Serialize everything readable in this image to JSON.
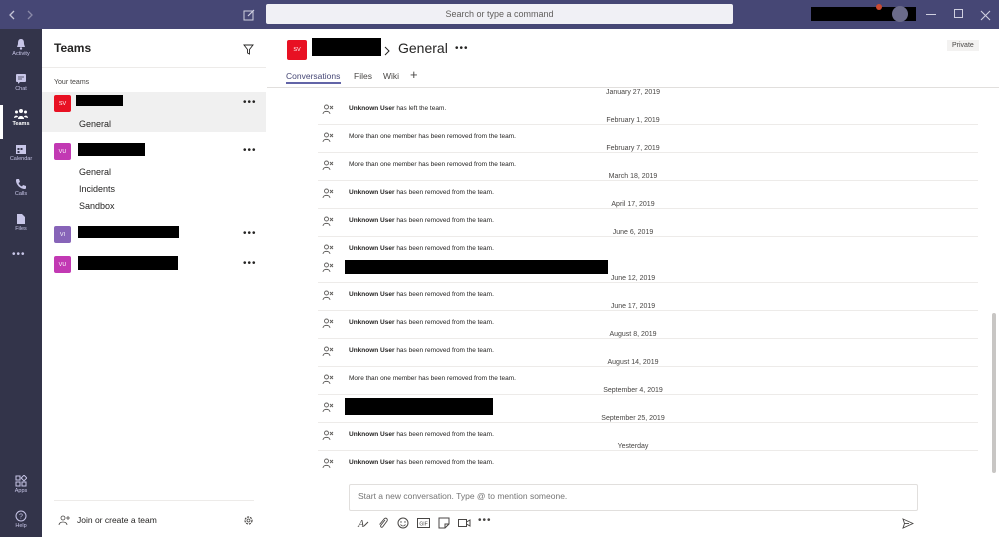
{
  "titlebar": {
    "search_placeholder": "Search or type a command",
    "icons": [
      "chevron-left-icon",
      "chevron-right-icon",
      "compose-icon",
      "minimize-icon",
      "restore-icon",
      "close-icon"
    ]
  },
  "rail": {
    "items": [
      {
        "label": "Activity",
        "icon": "bell-icon"
      },
      {
        "label": "Chat",
        "icon": "chat-icon"
      },
      {
        "label": "Teams",
        "icon": "teams-icon"
      },
      {
        "label": "Calendar",
        "icon": "calendar-icon"
      },
      {
        "label": "Calls",
        "icon": "phone-icon"
      },
      {
        "label": "Files",
        "icon": "file-icon"
      }
    ],
    "more": "•••",
    "bottom": [
      {
        "label": "Apps",
        "icon": "apps-icon"
      },
      {
        "label": "Help",
        "icon": "help-icon"
      }
    ]
  },
  "teams_pane": {
    "title": "Teams",
    "section_label": "Your teams",
    "teams": [
      {
        "avatar": "SV",
        "color": "#e81123",
        "channels": [
          "General"
        ]
      },
      {
        "avatar": "VU",
        "color": "#c239b3",
        "channels": [
          "General",
          "Incidents",
          "Sandbox"
        ]
      },
      {
        "avatar": "VI",
        "color": "#8764b8",
        "channels": []
      },
      {
        "avatar": "VU",
        "color": "#c239b3",
        "channels": []
      }
    ],
    "more_dots": "•••",
    "join_label": "Join or create a team"
  },
  "channel_header": {
    "avatar": "SV",
    "channel_name": "General",
    "more": "•••",
    "privacy": "Private",
    "tabs": [
      "Conversations",
      "Files",
      "Wiki"
    ],
    "add_tab": "+"
  },
  "feed": [
    {
      "date": "January 27, 2019",
      "user": "Unknown User",
      "text": " has left the team."
    },
    {
      "date": "February 1, 2019",
      "user": "",
      "text": "More than one member has been removed from the team."
    },
    {
      "date": "February 7, 2019",
      "user": "",
      "text": "More than one member has been removed from the team."
    },
    {
      "date": "March 18, 2019",
      "user": "Unknown User",
      "text": " has been removed from the team."
    },
    {
      "date": "April 17, 2019",
      "user": "Unknown User",
      "text": " has been removed from the team."
    },
    {
      "date": "June 6, 2019",
      "user": "Unknown User",
      "text": " has been removed from the team."
    },
    {
      "date": "June 12, 2019",
      "user": "Unknown User",
      "text": " has been removed from the team."
    },
    {
      "date": "June 17, 2019",
      "user": "Unknown User",
      "text": " has been removed from the team."
    },
    {
      "date": "August 8, 2019",
      "user": "Unknown User",
      "text": " has been removed from the team."
    },
    {
      "date": "August 14, 2019",
      "user": "",
      "text": "More than one member has been removed from the team."
    },
    {
      "date": "September 4, 2019",
      "user": "",
      "text": ""
    },
    {
      "date": "September 25, 2019",
      "user": "Unknown User",
      "text": " has been removed from the team."
    },
    {
      "date": "Yesterday",
      "user": "Unknown User",
      "text": " has been removed from the team."
    }
  ],
  "composer": {
    "placeholder": "Start a new conversation. Type @ to mention someone.",
    "tools": [
      "format-icon",
      "attach-icon",
      "emoji-icon",
      "gif-icon",
      "sticker-icon",
      "meet-icon",
      "more-icon"
    ],
    "send_icon": "send-icon"
  }
}
